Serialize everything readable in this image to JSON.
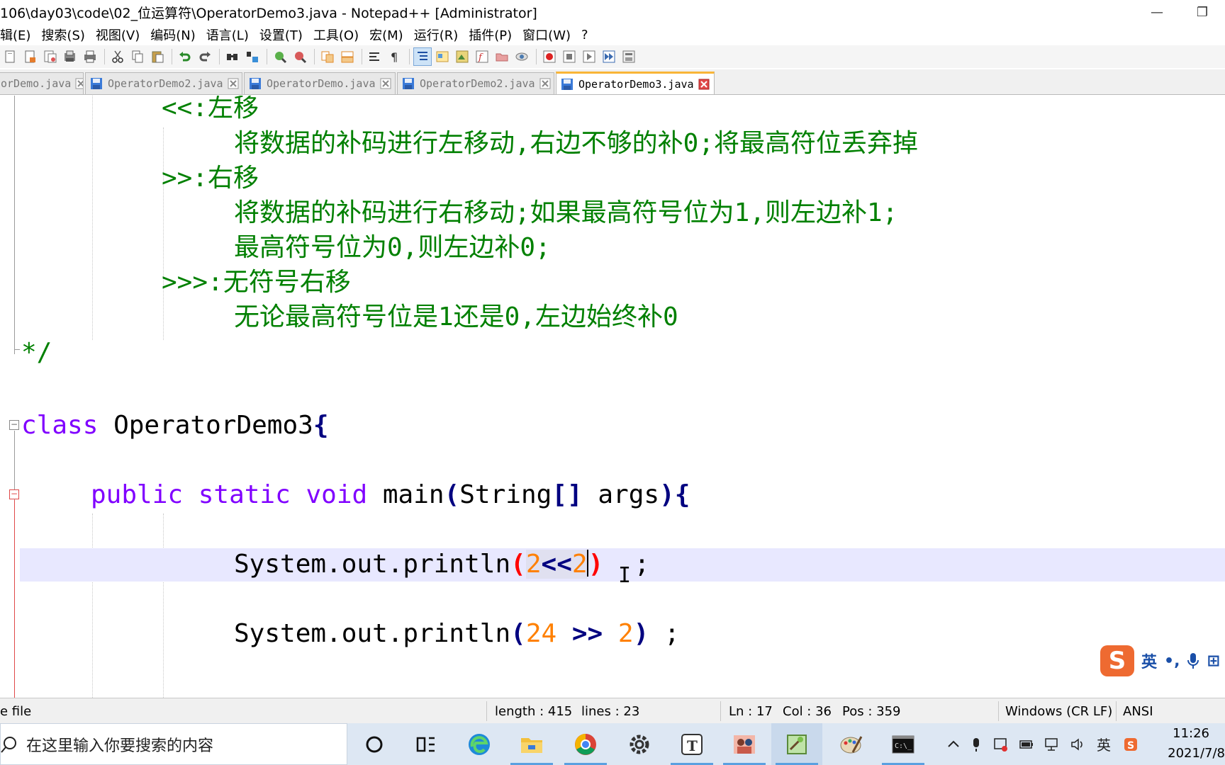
{
  "window": {
    "title": "106\\day03\\code\\02_位运算符\\OperatorDemo3.java - Notepad++ [Administrator]",
    "minimize_glyph": "—",
    "restore_glyph": "❐"
  },
  "menu": {
    "items": [
      "辑(E)",
      "搜索(S)",
      "视图(V)",
      "编码(N)",
      "语言(L)",
      "设置(T)",
      "工具(O)",
      "宏(M)",
      "运行(R)",
      "插件(P)",
      "窗口(W)",
      "?"
    ]
  },
  "toolbar": {
    "icons": [
      "new-file-icon",
      "open-file-icon",
      "save-icon",
      "save-all-icon",
      "print-icon",
      "cut-icon",
      "copy-icon",
      "paste-icon",
      "undo-icon",
      "redo-icon",
      "find-icon",
      "replace-icon",
      "zoom-in-icon",
      "zoom-out-icon",
      "sync-vertical-icon",
      "sync-horizontal-icon",
      "word-wrap-icon",
      "show-all-chars-icon",
      "indent-guide-icon",
      "language-icon",
      "doc-map-icon",
      "function-list-icon",
      "folder-workspace-icon",
      "monitor-icon",
      "record-macro-icon",
      "stop-macro-icon",
      "play-macro-icon",
      "run-macro-multiple-icon",
      "save-macro-icon"
    ]
  },
  "tabs": [
    {
      "label": "orDemo.java",
      "active": false
    },
    {
      "label": "OperatorDemo2.java",
      "active": false
    },
    {
      "label": "OperatorDemo.java",
      "active": false
    },
    {
      "label": "OperatorDemo2.java",
      "active": false
    },
    {
      "label": "OperatorDemo3.java",
      "active": true
    }
  ],
  "code": {
    "lines": [
      {
        "kind": "comment",
        "text": "<<:左移"
      },
      {
        "kind": "comment",
        "text": "将数据的补码进行左移动,右边不够的补0;将最高符位丢弃掉"
      },
      {
        "kind": "comment",
        "text": ">>:右移"
      },
      {
        "kind": "comment",
        "text": "将数据的补码进行右移动;如果最高符号位为1,则左边补1;"
      },
      {
        "kind": "comment",
        "text": "最高符号位为0,则左边补0;"
      },
      {
        "kind": "comment",
        "text": ">>>:无符号右移"
      },
      {
        "kind": "comment",
        "text": "无论最高符号位是1还是0,左边始终补0"
      },
      {
        "kind": "comment",
        "text": "*/"
      }
    ],
    "class_line": {
      "keyword": "class",
      "name": "OperatorDemo3",
      "brace": "{"
    },
    "main_line": {
      "kw1": "public",
      "kw2": "static",
      "kw3": "void",
      "name": "main",
      "lparen": "(",
      "type": "String",
      "brackets": "[]",
      "arg": "args",
      "rparen": ")",
      "brace": "{"
    },
    "print1": {
      "call": "System.out.println",
      "lparen": "(",
      "left": "2",
      "op": "<<",
      "right": "2",
      "rparen": ")",
      "tail": "  ;"
    },
    "print2": {
      "call": "System.out.println",
      "lparen": "(",
      "left": "24",
      "op": ">>",
      "right": "2",
      "rparen": ")",
      "tail": " ;"
    }
  },
  "ime": {
    "logo": "S",
    "lang": "英",
    "punct": "•,",
    "more": "⊞"
  },
  "status": {
    "file_type": "e file",
    "length": "length : 415",
    "lines": "lines : 23",
    "ln": "Ln : 17",
    "col": "Col : 36",
    "pos": "Pos : 359",
    "eol": "Windows (CR LF)",
    "encoding": "ANSI"
  },
  "taskbar": {
    "search_placeholder": "在这里输入你要搜索的内容",
    "tray_lang": "英",
    "time": "11:26",
    "date": "2021/7/8"
  },
  "colors": {
    "comment": "#008000",
    "keyword": "#8000ff",
    "number": "#ff8000",
    "operator": "#000080",
    "current_line": "#e8e8ff",
    "active_tab_accent": "#f9b537"
  }
}
